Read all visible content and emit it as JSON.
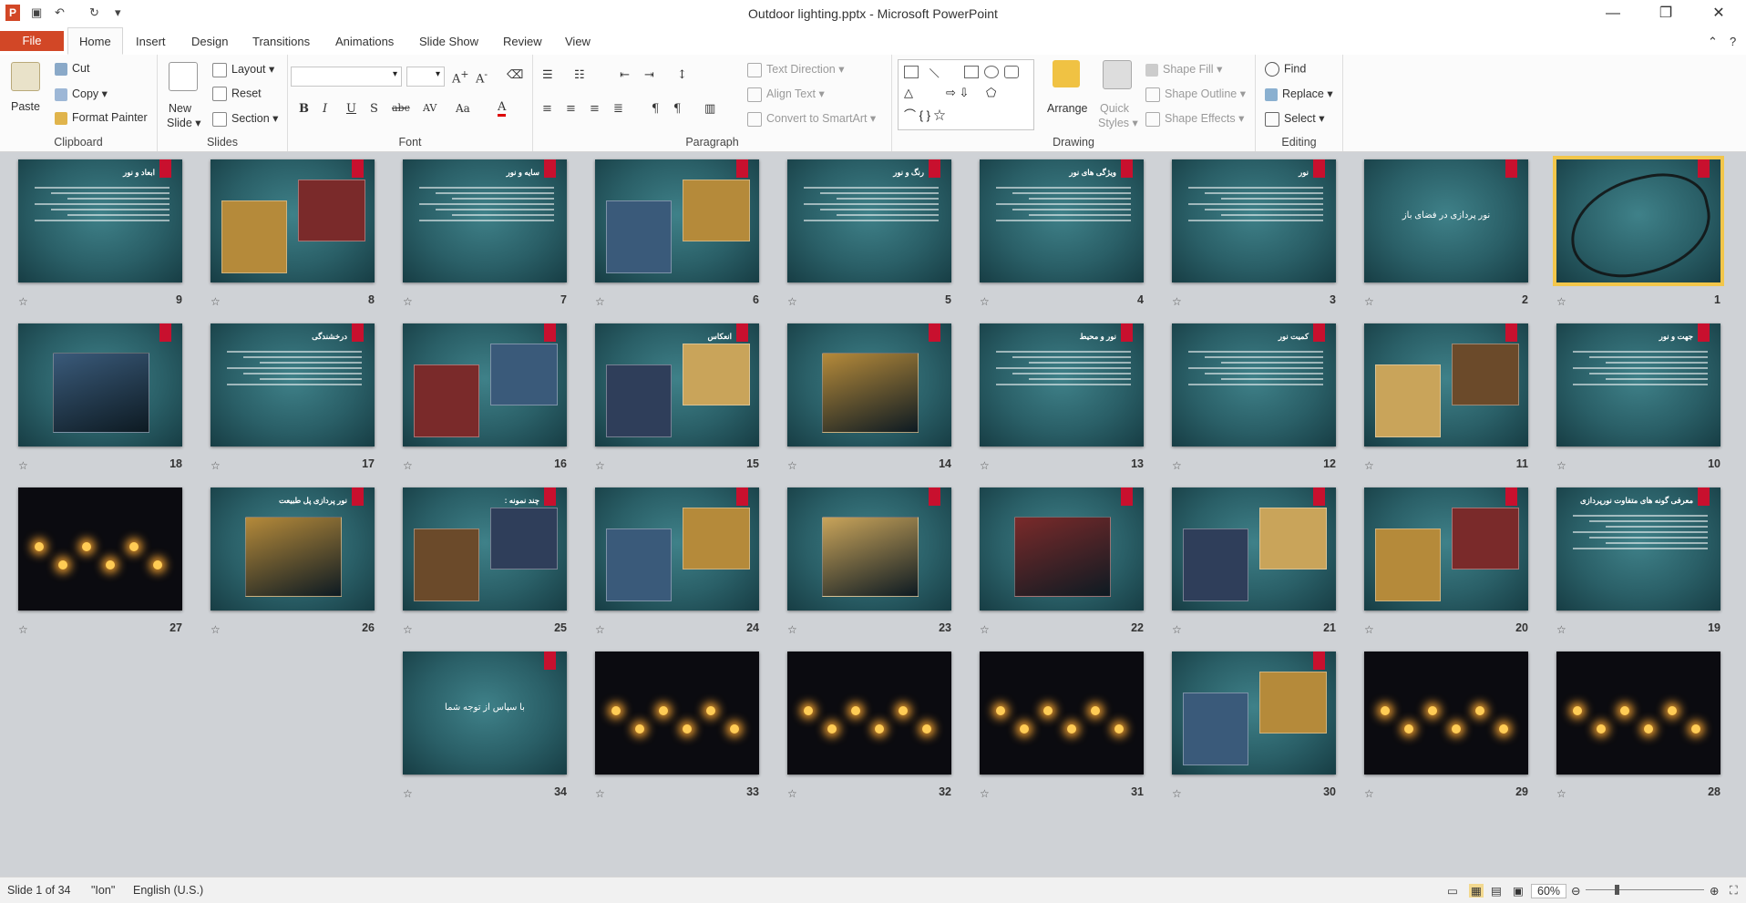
{
  "window": {
    "title": "Outdoor lighting.pptx  -  Microsoft PowerPoint"
  },
  "ribbon_tabs": [
    "File",
    "Home",
    "Insert",
    "Design",
    "Transitions",
    "Animations",
    "Slide Show",
    "Review",
    "View"
  ],
  "clipboard": {
    "paste": "Paste",
    "cut": "Cut",
    "copy": "Copy",
    "format_painter": "Format Painter",
    "label": "Clipboard"
  },
  "slides_group": {
    "new_slide": "New",
    "new_slide2": "Slide",
    "layout": "Layout",
    "reset": "Reset",
    "section": "Section",
    "label": "Slides"
  },
  "font_group": {
    "label": "Font",
    "bold": "B",
    "italic": "I",
    "underline": "U",
    "strike": "S",
    "spacing": "AV",
    "case": "Aa",
    "color": "A"
  },
  "paragraph_group": {
    "text_direction": "Text Direction",
    "align_text": "Align Text",
    "convert_smartart": "Convert to SmartArt",
    "label": "Paragraph"
  },
  "drawing_group": {
    "arrange": "Arrange",
    "quick_styles": "Quick",
    "quick_styles2": "Styles",
    "shape_fill": "Shape Fill",
    "shape_outline": "Shape Outline",
    "shape_effects": "Shape Effects",
    "label": "Drawing"
  },
  "editing_group": {
    "find": "Find",
    "replace": "Replace",
    "select": "Select",
    "label": "Editing"
  },
  "slides": [
    {
      "n": "1",
      "title": "",
      "kind": "calligraphy"
    },
    {
      "n": "2",
      "title": "نور پردازی در فضای باز",
      "kind": "title"
    },
    {
      "n": "3",
      "title": "نور",
      "kind": "text"
    },
    {
      "n": "4",
      "title": "ویژگی های نور",
      "kind": "text"
    },
    {
      "n": "5",
      "title": "رنگ و نور",
      "kind": "text"
    },
    {
      "n": "6",
      "title": "",
      "kind": "pics"
    },
    {
      "n": "7",
      "title": "سایه و نور",
      "kind": "text"
    },
    {
      "n": "8",
      "title": "",
      "kind": "pics"
    },
    {
      "n": "9",
      "title": "ابعاد و نور",
      "kind": "text"
    },
    {
      "n": "10",
      "title": "جهت و نور",
      "kind": "text"
    },
    {
      "n": "11",
      "title": "",
      "kind": "pics"
    },
    {
      "n": "12",
      "title": "کمیت نور",
      "kind": "text"
    },
    {
      "n": "13",
      "title": "نور و محیط",
      "kind": "text"
    },
    {
      "n": "14",
      "title": "",
      "kind": "pic1"
    },
    {
      "n": "15",
      "title": "انعکاس",
      "kind": "pics"
    },
    {
      "n": "16",
      "title": "",
      "kind": "pics"
    },
    {
      "n": "17",
      "title": "درخشندگی",
      "kind": "text"
    },
    {
      "n": "18",
      "title": "",
      "kind": "pic1"
    },
    {
      "n": "19",
      "title": "معرفی گونه های متفاوت نورپردازی",
      "kind": "text"
    },
    {
      "n": "20",
      "title": "",
      "kind": "pics"
    },
    {
      "n": "21",
      "title": "",
      "kind": "pics"
    },
    {
      "n": "22",
      "title": "",
      "kind": "pic1"
    },
    {
      "n": "23",
      "title": "",
      "kind": "pic1"
    },
    {
      "n": "24",
      "title": "",
      "kind": "pics"
    },
    {
      "n": "25",
      "title": "چند نمونه :",
      "kind": "pics"
    },
    {
      "n": "26",
      "title": "نور پردازی پل طبیعت",
      "kind": "pic1"
    },
    {
      "n": "27",
      "title": "",
      "kind": "dark"
    },
    {
      "n": "28",
      "title": "",
      "kind": "dark"
    },
    {
      "n": "29",
      "title": "",
      "kind": "dark"
    },
    {
      "n": "30",
      "title": "",
      "kind": "pics"
    },
    {
      "n": "31",
      "title": "",
      "kind": "dark"
    },
    {
      "n": "32",
      "title": "",
      "kind": "dark"
    },
    {
      "n": "33",
      "title": "",
      "kind": "dark"
    },
    {
      "n": "34",
      "title": "با سپاس از توجه شما",
      "kind": "end"
    }
  ],
  "status": {
    "slide_info": "Slide 1 of 34",
    "theme": "\"Ion\"",
    "language": "English (U.S.)",
    "zoom": "60%"
  }
}
